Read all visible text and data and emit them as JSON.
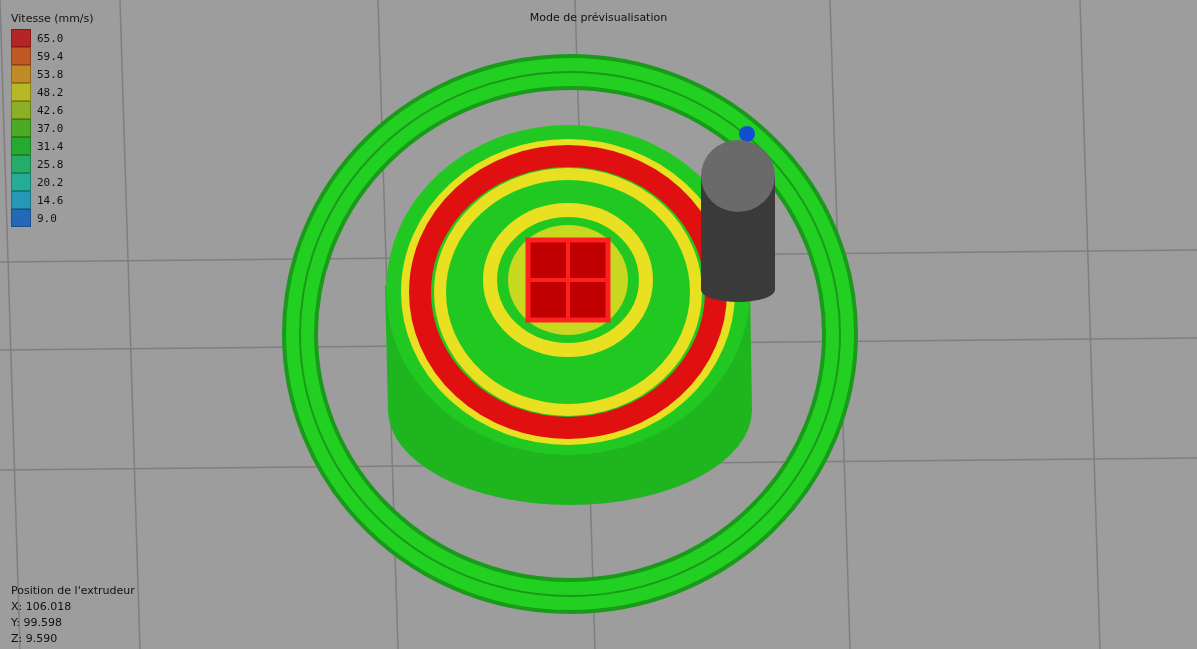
{
  "title": "Mode de prévisualisation",
  "legend": {
    "title": "Vitesse (mm/s)",
    "items": [
      {
        "label": "65.0",
        "color": "#b52525"
      },
      {
        "label": "59.4",
        "color": "#c05a25"
      },
      {
        "label": "53.8",
        "color": "#c08a25"
      },
      {
        "label": "48.2",
        "color": "#b8b825"
      },
      {
        "label": "42.6",
        "color": "#8cb025"
      },
      {
        "label": "37.0",
        "color": "#4aac25"
      },
      {
        "label": "31.4",
        "color": "#25ac30"
      },
      {
        "label": "25.8",
        "color": "#25ac68"
      },
      {
        "label": "20.2",
        "color": "#25ac98"
      },
      {
        "label": "14.6",
        "color": "#2598b8"
      },
      {
        "label": "9.0",
        "color": "#2568b8"
      }
    ]
  },
  "extruder_position": {
    "title": "Position de l'extrudeur",
    "lines": [
      "X: 106.018",
      "Y: 99.598",
      "Z: 9.590"
    ]
  }
}
